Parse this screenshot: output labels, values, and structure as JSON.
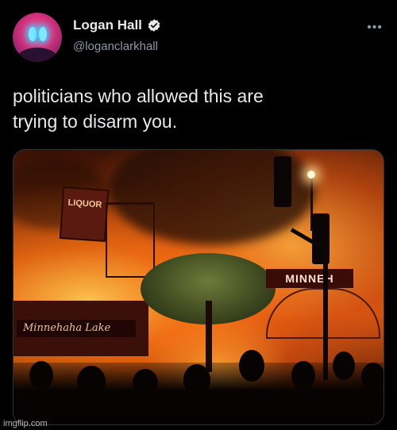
{
  "author": {
    "display_name": "Logan Hall",
    "handle": "@loganclarkhall",
    "verified_icon": "verified-badge-icon",
    "verified_color": "#1d9bf0"
  },
  "menu_icon": "more-options-icon",
  "tweet": {
    "text_line1": "politicians who allowed this are",
    "text_line2": "trying to disarm you."
  },
  "media": {
    "sign_liquor": "LIQUOR",
    "sign_lake": "Minnehaha Lake",
    "sign_minneh": "MINNEH"
  },
  "watermark": "imgflip.com"
}
